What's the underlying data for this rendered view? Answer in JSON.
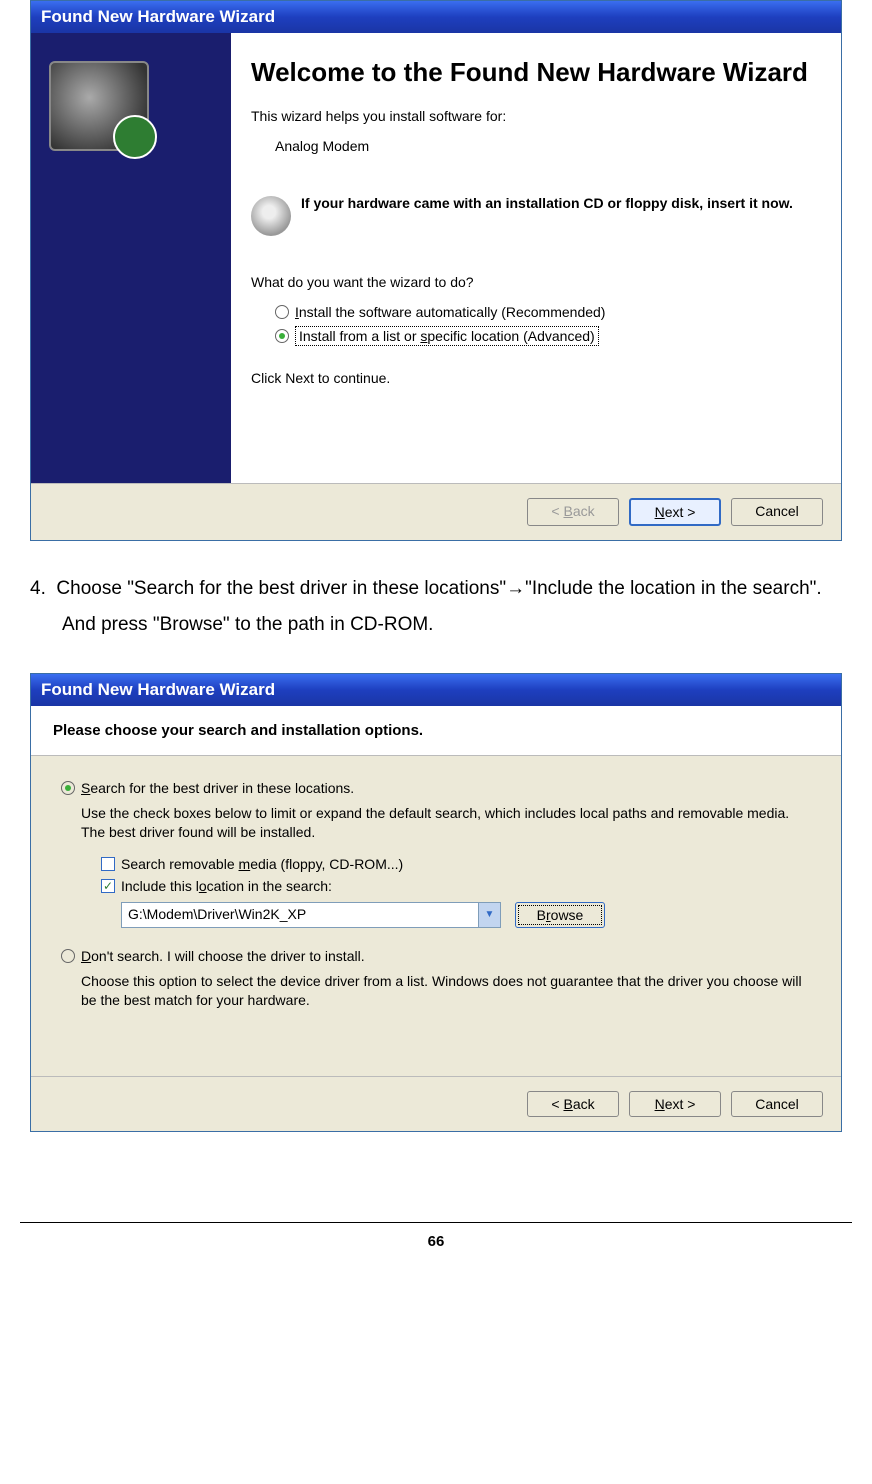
{
  "wizard1": {
    "title": "Found New Hardware Wizard",
    "heading": "Welcome to the Found New Hardware Wizard",
    "intro": "This wizard helps you install software for:",
    "device": "Analog Modem",
    "cd_note": "If your hardware came with an installation CD or floppy disk, insert it now.",
    "prompt": "What do you want the wizard to do?",
    "option1": "Install the software automatically (Recommended)",
    "option2": "Install from a list or specific location (Advanced)",
    "continue": "Click Next to continue.",
    "back": "< Back",
    "next": "Next >",
    "cancel": "Cancel"
  },
  "instruction": {
    "num": "4.",
    "text": "Choose \"Search for the best driver in these locations\"→\"Include the location in the search\". And press \"Browse\" to the path in CD-ROM."
  },
  "wizard2": {
    "title": "Found New Hardware Wizard",
    "heading": "Please choose your search and installation options.",
    "opt_search": "Search for the best driver in these locations.",
    "opt_search_desc": "Use the check boxes below to limit or expand the default search, which includes local paths and removable media. The best driver found will be installed.",
    "chk_removable": "Search removable media (floppy, CD-ROM...)",
    "chk_include": "Include this location in the search:",
    "path": "G:\\Modem\\Driver\\Win2K_XP",
    "browse": "Browse",
    "opt_dont": "Don't search. I will choose the driver to install.",
    "opt_dont_desc": "Choose this option to select the device driver from a list.  Windows does not guarantee that the driver you choose will be the best match for your hardware.",
    "back": "< Back",
    "next": "Next >",
    "cancel": "Cancel"
  },
  "page_number": "66"
}
